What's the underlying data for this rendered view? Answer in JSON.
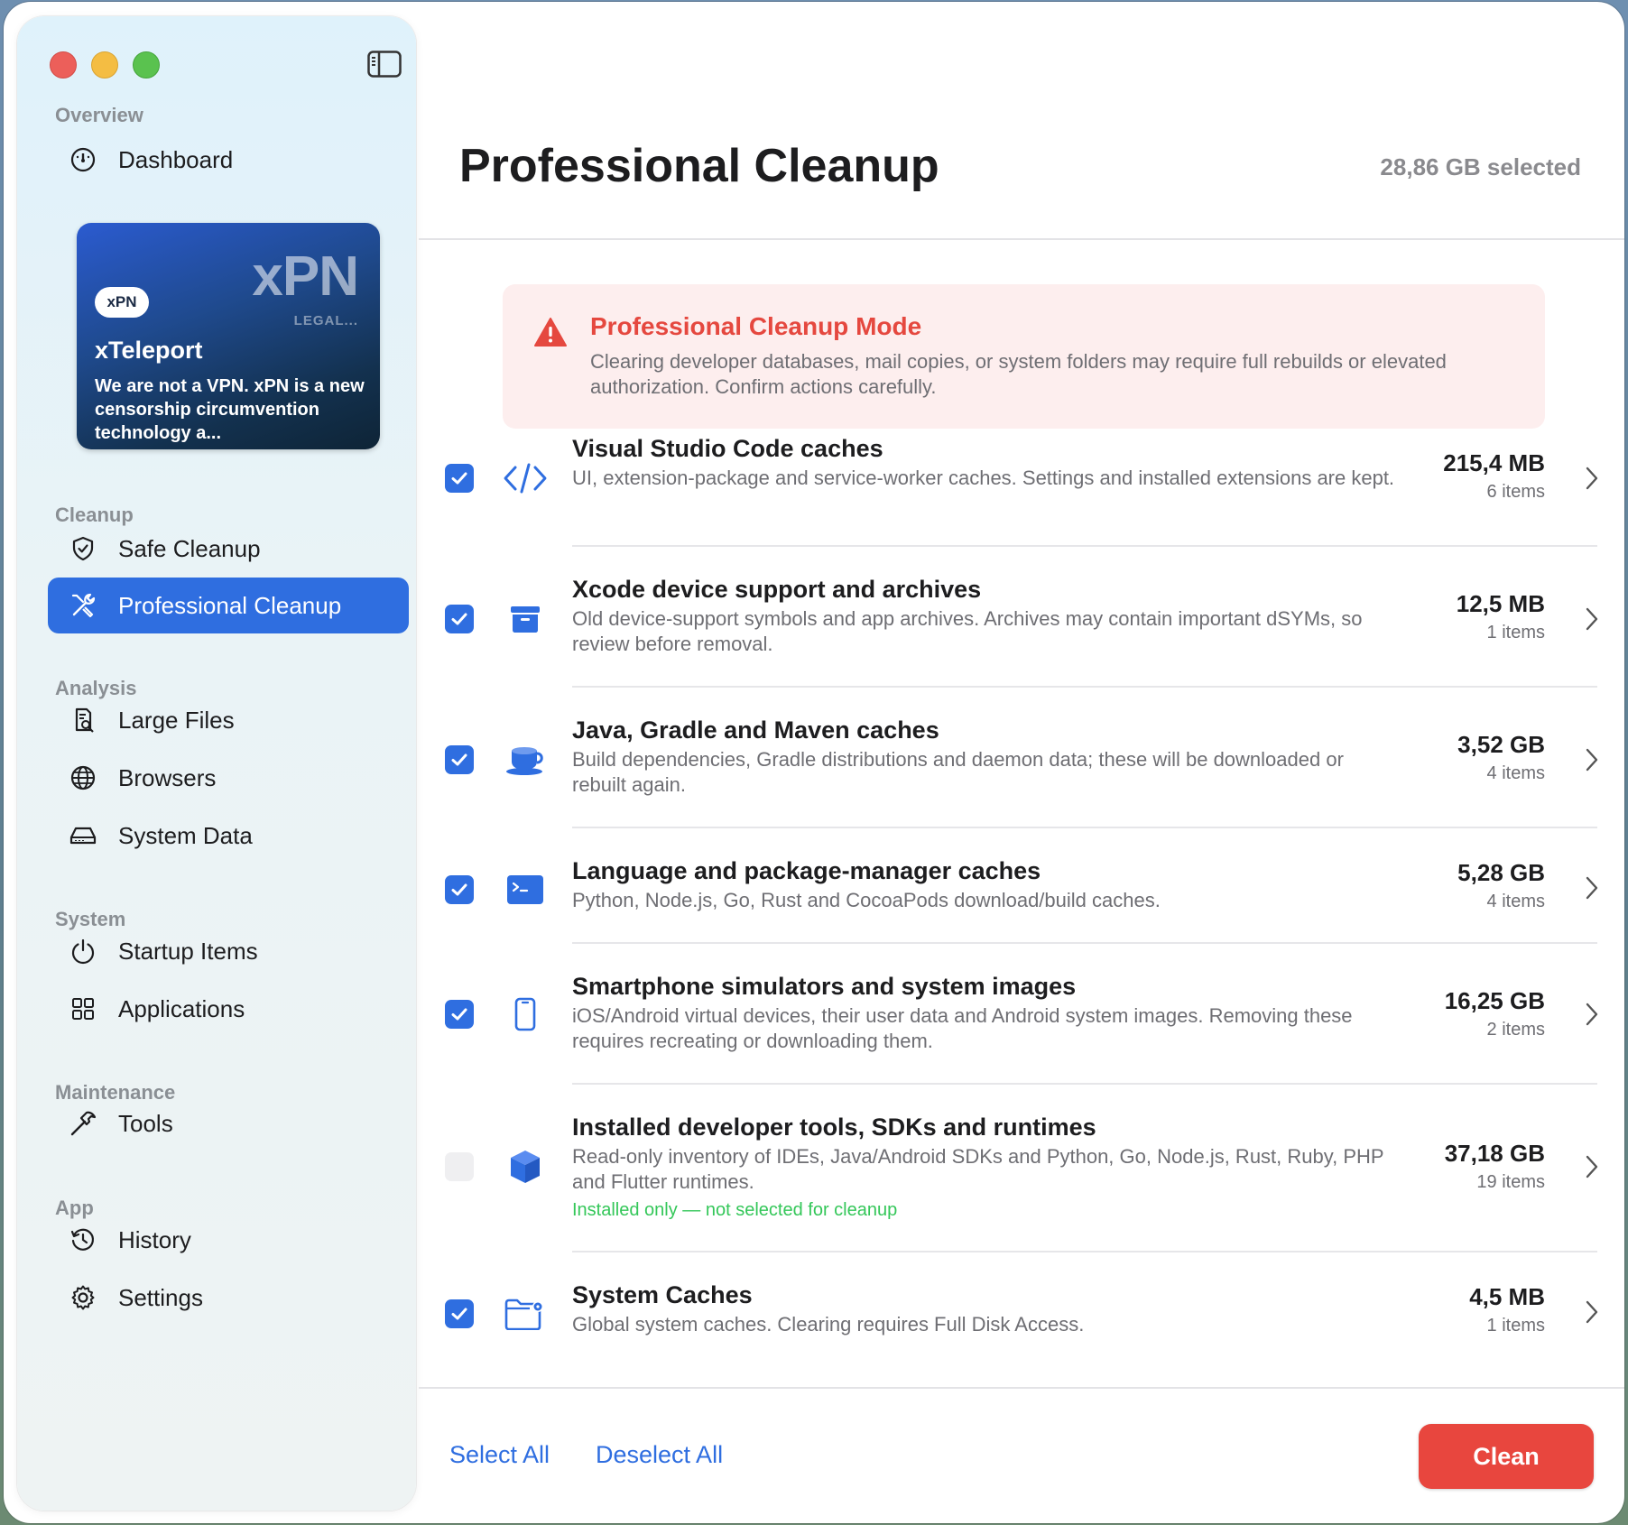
{
  "sidebar": {
    "sections": {
      "overview": "Overview",
      "cleanup": "Cleanup",
      "analysis": "Analysis",
      "system": "System",
      "maintenance": "Maintenance",
      "app": "App"
    },
    "items": {
      "dashboard": "Dashboard",
      "safe_cleanup": "Safe Cleanup",
      "professional_cleanup": "Professional Cleanup",
      "large_files": "Large Files",
      "browsers": "Browsers",
      "system_data": "System Data",
      "startup_items": "Startup Items",
      "applications": "Applications",
      "tools": "Tools",
      "history": "History",
      "settings": "Settings"
    },
    "active_item": "professional_cleanup",
    "promo": {
      "badge": "xPN",
      "brand": "xPN",
      "legal": "LEGAL...",
      "title": "xTeleport",
      "description": "We are not a VPN. xPN is a new censorship circumvention technology a..."
    }
  },
  "header": {
    "title": "Professional Cleanup",
    "selected_total": "28,86 GB selected"
  },
  "alert": {
    "icon": "warning-triangle-icon",
    "title": "Professional Cleanup Mode",
    "text": "Clearing developer databases, mail copies, or system folders may require full rebuilds or elevated authorization. Confirm actions carefully."
  },
  "rows": [
    {
      "icon": "code-brackets-icon",
      "checked": true,
      "title": "Visual Studio Code caches",
      "description": "UI, extension-package and service-worker caches. Settings and installed extensions are kept.",
      "size": "215,4 MB",
      "count": "6 items"
    },
    {
      "icon": "archive-box-icon",
      "checked": true,
      "title": "Xcode device support and archives",
      "description": "Old device-support symbols and app archives. Archives may contain important dSYMs, so review before removal.",
      "size": "12,5 MB",
      "count": "1 items"
    },
    {
      "icon": "coffee-cup-icon",
      "checked": true,
      "title": "Java, Gradle and Maven caches",
      "description": "Build dependencies, Gradle distributions and daemon data; these will be downloaded or rebuilt again.",
      "size": "3,52 GB",
      "count": "4 items"
    },
    {
      "icon": "terminal-icon",
      "checked": true,
      "title": "Language and package-manager caches",
      "description": "Python, Node.js, Go, Rust and CocoaPods download/build caches.",
      "size": "5,28 GB",
      "count": "4 items"
    },
    {
      "icon": "smartphone-icon",
      "checked": true,
      "title": "Smartphone simulators and system images",
      "description": "iOS/Android virtual devices, their user data and Android system images. Removing these requires recreating or downloading them.",
      "size": "16,25 GB",
      "count": "2 items"
    },
    {
      "icon": "cube-icon",
      "checked": false,
      "title": "Installed developer tools, SDKs and runtimes",
      "description": "Read-only inventory of IDEs, Java/Android SDKs and Python, Go, Node.js, Rust, Ruby, PHP and Flutter runtimes.",
      "note": "Installed only — not selected for cleanup",
      "size": "37,18 GB",
      "count": "19 items"
    },
    {
      "icon": "folder-gear-icon",
      "checked": true,
      "title": "System Caches",
      "description": "Global system caches. Clearing requires Full Disk Access.",
      "size": "4,5 MB",
      "count": "1 items"
    }
  ],
  "footer": {
    "select_all": "Select All",
    "deselect_all": "Deselect All",
    "clean": "Clean"
  },
  "colors": {
    "accent": "#2f6ee0",
    "danger": "#e8463e",
    "warning_text": "#e5483f",
    "success_note": "#34c759"
  }
}
